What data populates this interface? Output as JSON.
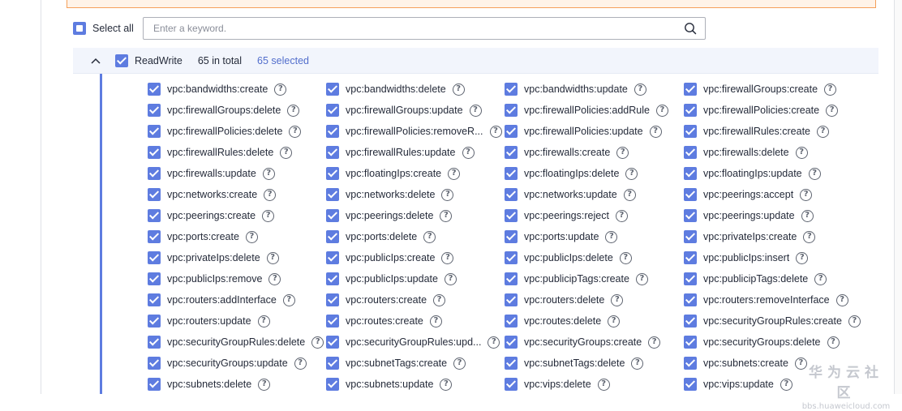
{
  "toolbar": {
    "select_all_label": "Select all",
    "search_placeholder": "Enter a keyword."
  },
  "group": {
    "name": "ReadWrite",
    "total_text": "65 in total",
    "selected_text": "65 selected",
    "expanded": true,
    "checked": true
  },
  "permissions": [
    "vpc:bandwidths:create",
    "vpc:bandwidths:delete",
    "vpc:bandwidths:update",
    "vpc:firewallGroups:create",
    "vpc:firewallGroups:delete",
    "vpc:firewallGroups:update",
    "vpc:firewallPolicies:addRule",
    "vpc:firewallPolicies:create",
    "vpc:firewallPolicies:delete",
    "vpc:firewallPolicies:removeR...",
    "vpc:firewallPolicies:update",
    "vpc:firewallRules:create",
    "vpc:firewallRules:delete",
    "vpc:firewallRules:update",
    "vpc:firewalls:create",
    "vpc:firewalls:delete",
    "vpc:firewalls:update",
    "vpc:floatingIps:create",
    "vpc:floatingIps:delete",
    "vpc:floatingIps:update",
    "vpc:networks:create",
    "vpc:networks:delete",
    "vpc:networks:update",
    "vpc:peerings:accept",
    "vpc:peerings:create",
    "vpc:peerings:delete",
    "vpc:peerings:reject",
    "vpc:peerings:update",
    "vpc:ports:create",
    "vpc:ports:delete",
    "vpc:ports:update",
    "vpc:privateIps:create",
    "vpc:privateIps:delete",
    "vpc:publicIps:create",
    "vpc:publicIps:delete",
    "vpc:publicIps:insert",
    "vpc:publicIps:remove",
    "vpc:publicIps:update",
    "vpc:publicipTags:create",
    "vpc:publicipTags:delete",
    "vpc:routers:addInterface",
    "vpc:routers:create",
    "vpc:routers:delete",
    "vpc:routers:removeInterface",
    "vpc:routers:update",
    "vpc:routes:create",
    "vpc:routes:delete",
    "vpc:securityGroupRules:create",
    "vpc:securityGroupRules:delete",
    "vpc:securityGroupRules:upd...",
    "vpc:securityGroups:create",
    "vpc:securityGroups:delete",
    "vpc:securityGroups:update",
    "vpc:subnetTags:create",
    "vpc:subnetTags:delete",
    "vpc:subnets:create",
    "vpc:subnets:delete",
    "vpc:subnets:update",
    "vpc:vips:delete",
    "vpc:vips:update"
  ],
  "watermark": {
    "brand_cn": "华为云社区",
    "url": "bbs.huaweicloud.com"
  },
  "colors": {
    "accent": "#5e7ce0",
    "selected_text": "#526ecc",
    "group_header_bg": "#f2f5fc",
    "warning_border": "#f5a05a"
  }
}
